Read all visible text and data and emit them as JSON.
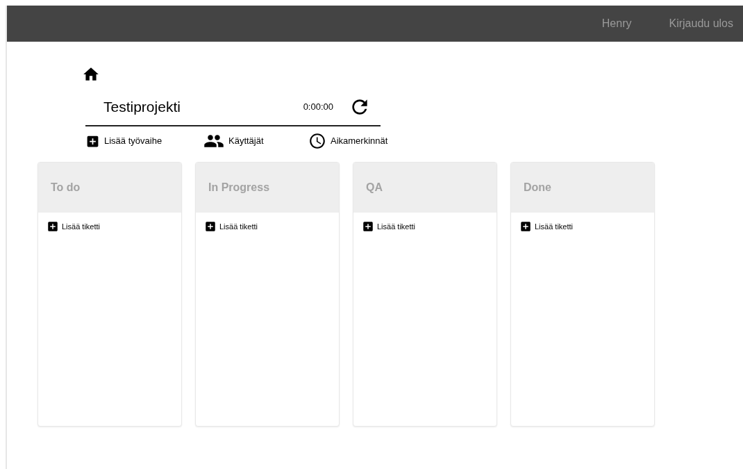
{
  "navbar": {
    "user": "Henry",
    "logout": "Kirjaudu ulos"
  },
  "project": {
    "title": "Testiprojekti",
    "timer": "0:00:00"
  },
  "actions": [
    {
      "kind": "add",
      "label": "Lisää työvaihe"
    },
    {
      "kind": "users",
      "label": "Käyttäjät"
    },
    {
      "kind": "time",
      "label": "Aikamerkinnät"
    }
  ],
  "columns": [
    {
      "title": "To do",
      "add_label": "Lisää tiketti"
    },
    {
      "title": "In Progress",
      "add_label": "Lisää tiketti"
    },
    {
      "title": "QA",
      "add_label": "Lisää tiketti"
    },
    {
      "title": "Done",
      "add_label": "Lisää tiketti"
    }
  ]
}
